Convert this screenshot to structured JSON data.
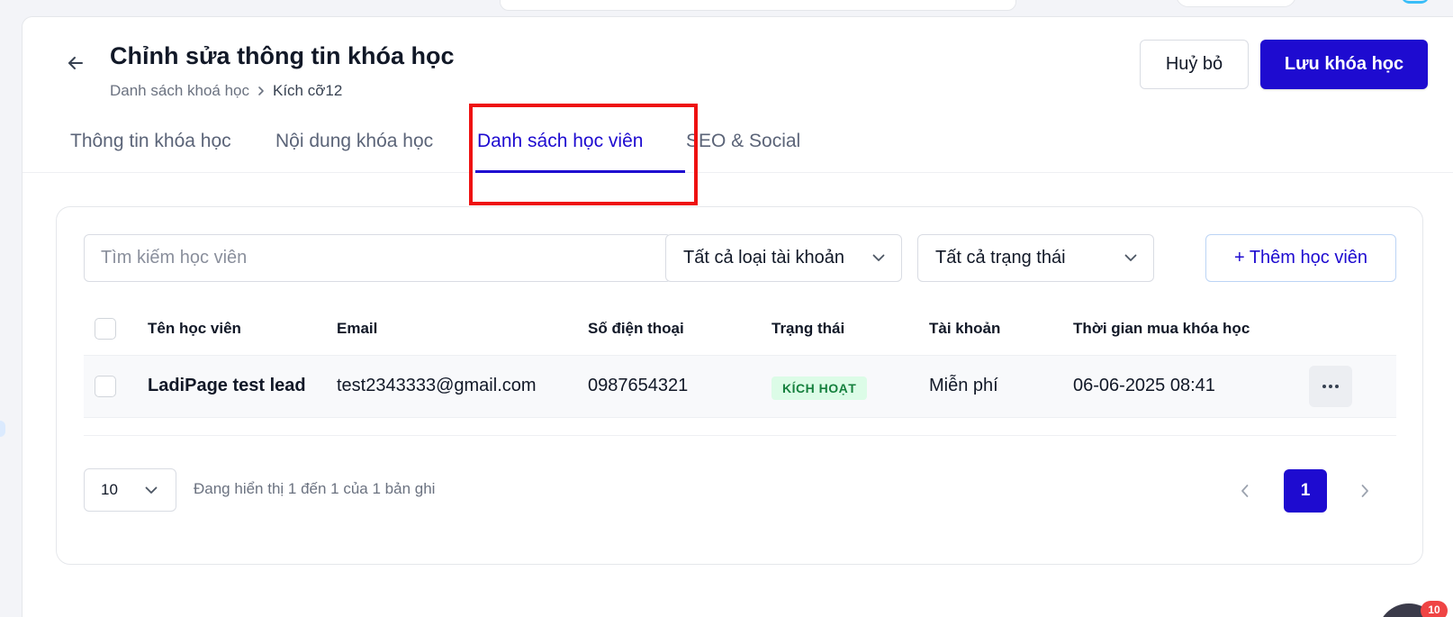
{
  "header": {
    "title": "Chỉnh sửa thông tin khóa học",
    "breadcrumb": {
      "parent": "Danh sách khoá học",
      "current": "Kích cỡ12"
    },
    "cancel_label": "Huỷ bỏ",
    "save_label": "Lưu khóa học"
  },
  "tabs": [
    {
      "label": "Thông tin khóa học",
      "active": false
    },
    {
      "label": "Nội dung khóa học",
      "active": false
    },
    {
      "label": "Danh sách học viên",
      "active": true
    },
    {
      "label": "SEO & Social",
      "active": false
    }
  ],
  "filters": {
    "search_placeholder": "Tìm kiếm học viên",
    "account_type": "Tất cả loại tài khoản",
    "status": "Tất cả trạng thái",
    "add_label": "+ Thêm học viên"
  },
  "table": {
    "columns": [
      "Tên học viên",
      "Email",
      "Số điện thoại",
      "Trạng thái",
      "Tài khoản",
      "Thời gian mua khóa học"
    ],
    "rows": [
      {
        "name": "LadiPage test lead",
        "email": "test2343333@gmail.com",
        "phone": "0987654321",
        "status": "KÍCH HOẠT",
        "account": "Miễn phí",
        "purchased_at": "06-06-2025 08:41"
      }
    ]
  },
  "pagination": {
    "page_size": "10",
    "summary": "Đang hiển thị 1 đến 1 của 1 bản ghi",
    "current_page": "1"
  },
  "notifications": {
    "count": "10"
  },
  "colors": {
    "primary": "#1e0bd0",
    "highlight": "#ee1111",
    "status_active_bg": "#dcfce7",
    "status_active_text": "#15803d"
  },
  "icons": [
    "arrow-left-icon",
    "chevron-right-icon",
    "chevron-down-icon",
    "more-horizontal-icon",
    "chevron-left-icon"
  ]
}
